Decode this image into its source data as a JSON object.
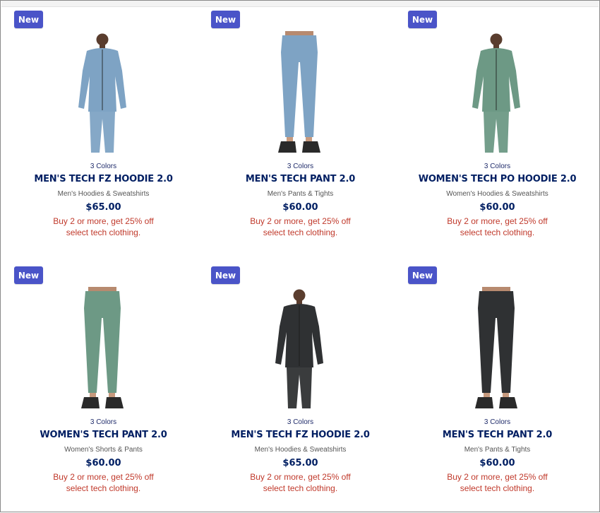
{
  "products": [
    {
      "badge": "New",
      "colors": "3 Colors",
      "name": "MEN'S TECH FZ HOODIE 2.0",
      "category": "Men's Hoodies & Sweatshirts",
      "price": "$65.00",
      "promo_line1": "Buy 2 or more, get 25% off",
      "promo_line2": "select tech clothing.",
      "image_icon": "hoodie-full-figure",
      "garment_color": "#7ea3c4"
    },
    {
      "badge": "New",
      "colors": "3 Colors",
      "name": "MEN'S TECH PANT 2.0",
      "category": "Men's Pants & Tights",
      "price": "$60.00",
      "promo_line1": "Buy 2 or more, get 25% off",
      "promo_line2": "select tech clothing.",
      "image_icon": "pants-legs",
      "garment_color": "#7ea3c4"
    },
    {
      "badge": "New",
      "colors": "3 Colors",
      "name": "WOMEN'S TECH PO HOODIE 2.0",
      "category": "Women's Hoodies & Sweatshirts",
      "price": "$60.00",
      "promo_line1": "Buy 2 or more, get 25% off",
      "promo_line2": "select tech clothing.",
      "image_icon": "hoodie-full-figure",
      "garment_color": "#6d9985"
    },
    {
      "badge": "New",
      "colors": "3 Colors",
      "name": "WOMEN'S TECH PANT 2.0",
      "category": "Women's Shorts & Pants",
      "price": "$60.00",
      "promo_line1": "Buy 2 or more, get 25% off",
      "promo_line2": "select tech clothing.",
      "image_icon": "pants-legs",
      "garment_color": "#6d9985"
    },
    {
      "badge": "New",
      "colors": "3 Colors",
      "name": "MEN'S TECH FZ HOODIE 2.0",
      "category": "Men's Hoodies & Sweatshirts",
      "price": "$65.00",
      "promo_line1": "Buy 2 or more, get 25% off",
      "promo_line2": "select tech clothing.",
      "image_icon": "hoodie-full-figure",
      "garment_color": "#2f3133"
    },
    {
      "badge": "New",
      "colors": "3 Colors",
      "name": "MEN'S TECH PANT 2.0",
      "category": "Men's Pants & Tights",
      "price": "$60.00",
      "promo_line1": "Buy 2 or more, get 25% off",
      "promo_line2": "select tech clothing.",
      "image_icon": "pants-legs",
      "garment_color": "#2f3133"
    }
  ],
  "colors": {
    "badge_bg": "#4a54c8",
    "name": "#001e62",
    "promo": "#c0392b"
  }
}
